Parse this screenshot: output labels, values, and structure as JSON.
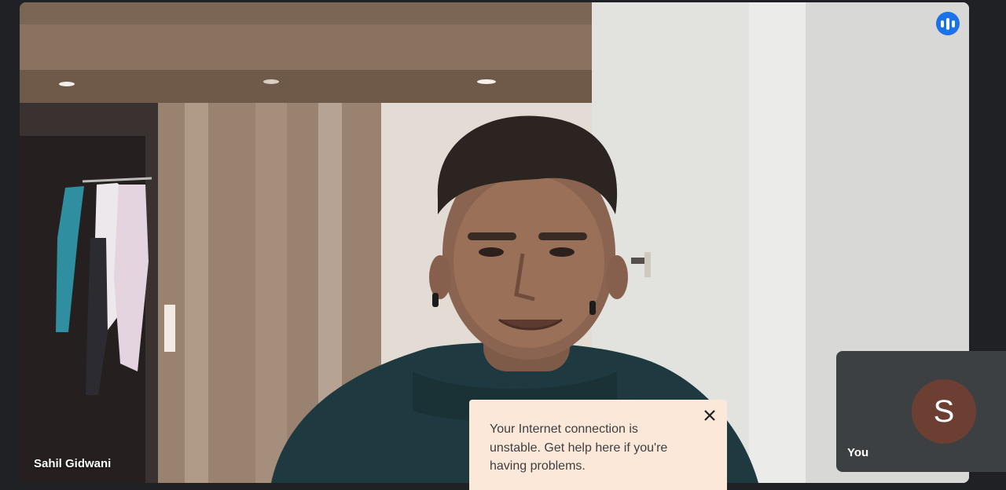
{
  "participant": {
    "name": "Sahil Gidwani",
    "speaking_indicator_icon": "speaking-indicator-icon"
  },
  "self_view": {
    "label": "You",
    "avatar_letter": "S",
    "avatar_color": "#6d3f33"
  },
  "notification": {
    "message": "Your Internet connection is unstable. Get help here if you're having problems.",
    "close_icon": "close-icon"
  },
  "colors": {
    "background": "#202124",
    "accent": "#1a73e8",
    "toast_background": "#fce8d8"
  }
}
